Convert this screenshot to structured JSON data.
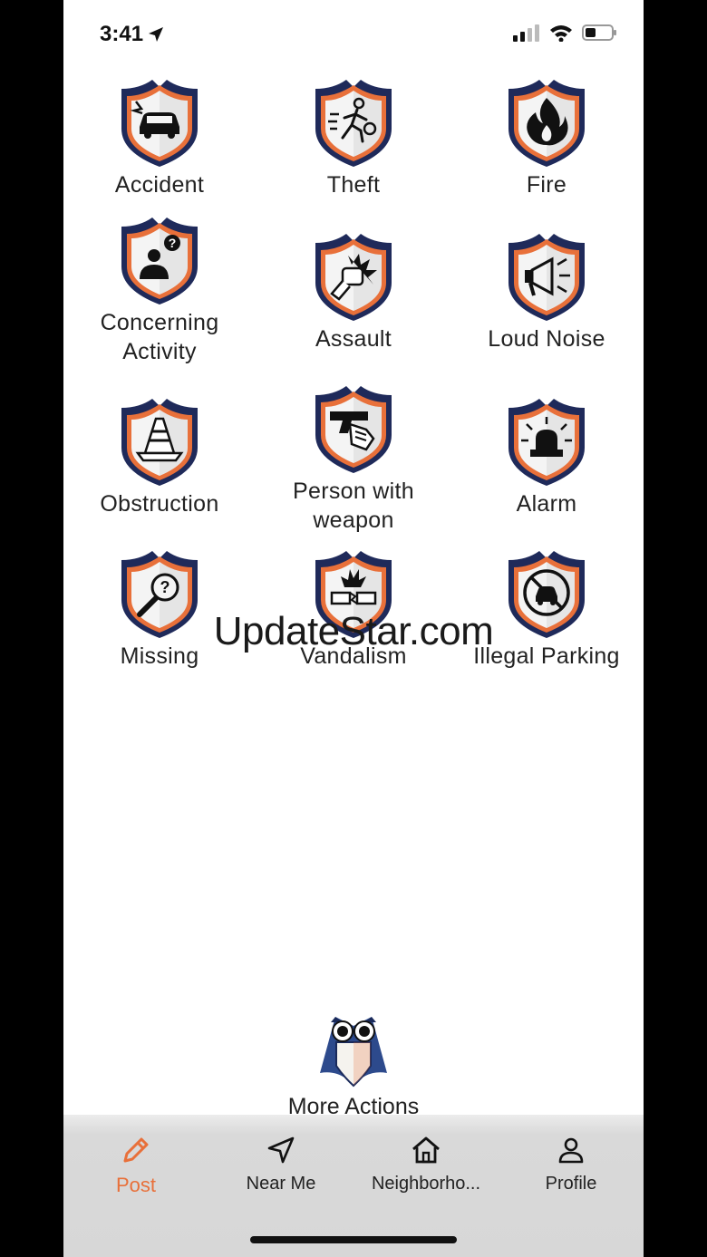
{
  "status_bar": {
    "time": "3:41",
    "icons": [
      "location-arrow-icon",
      "cellular-signal-icon",
      "wifi-icon",
      "battery-icon"
    ]
  },
  "colors": {
    "accent": "#e8703a",
    "shield_border": "#1f2a5a",
    "shield_orange": "#e8703a",
    "shield_fill": "#f4f4f4",
    "tab_bar": "#d8d8d8"
  },
  "categories": [
    {
      "label": "Accident",
      "icon": "car-crash-icon"
    },
    {
      "label": "Theft",
      "icon": "thief-running-icon"
    },
    {
      "label": "Fire",
      "icon": "flame-icon"
    },
    {
      "label": "Concerning Activity",
      "icon": "person-question-icon"
    },
    {
      "label": "Assault",
      "icon": "fist-punch-icon"
    },
    {
      "label": "Loud Noise",
      "icon": "megaphone-icon"
    },
    {
      "label": "Obstruction",
      "icon": "traffic-cone-icon"
    },
    {
      "label": "Person with weapon",
      "icon": "handgun-icon"
    },
    {
      "label": "Alarm",
      "icon": "siren-light-icon"
    },
    {
      "label": "Missing",
      "icon": "magnifier-question-icon"
    },
    {
      "label": "Vandalism",
      "icon": "broken-brick-icon"
    },
    {
      "label": "Illegal Parking",
      "icon": "no-parking-car-icon"
    }
  ],
  "watermark": "UpdateStar.com",
  "more_actions": {
    "label": "More Actions",
    "icon": "owl-logo-icon"
  },
  "tabs": [
    {
      "label": "Post",
      "icon": "pencil-icon",
      "active": true
    },
    {
      "label": "Near Me",
      "icon": "navigation-arrow-icon",
      "active": false
    },
    {
      "label": "Neighborho...",
      "icon": "home-icon",
      "active": false
    },
    {
      "label": "Profile",
      "icon": "person-icon",
      "active": false
    }
  ]
}
